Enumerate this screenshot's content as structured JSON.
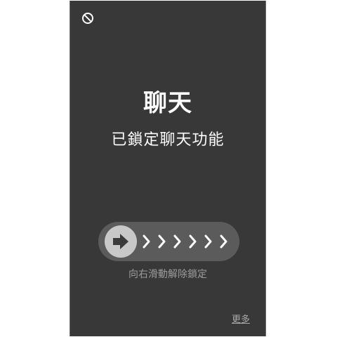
{
  "screen": {
    "top_icon": "no-entry-icon",
    "title": "聊天",
    "subtitle": "已鎖定聊天功能",
    "slider": {
      "knob_icon": "arrow-right-icon",
      "chevron_icon": "chevron-right-icon",
      "hint": "向右滑動解除鎖定"
    },
    "more_label": "更多"
  }
}
